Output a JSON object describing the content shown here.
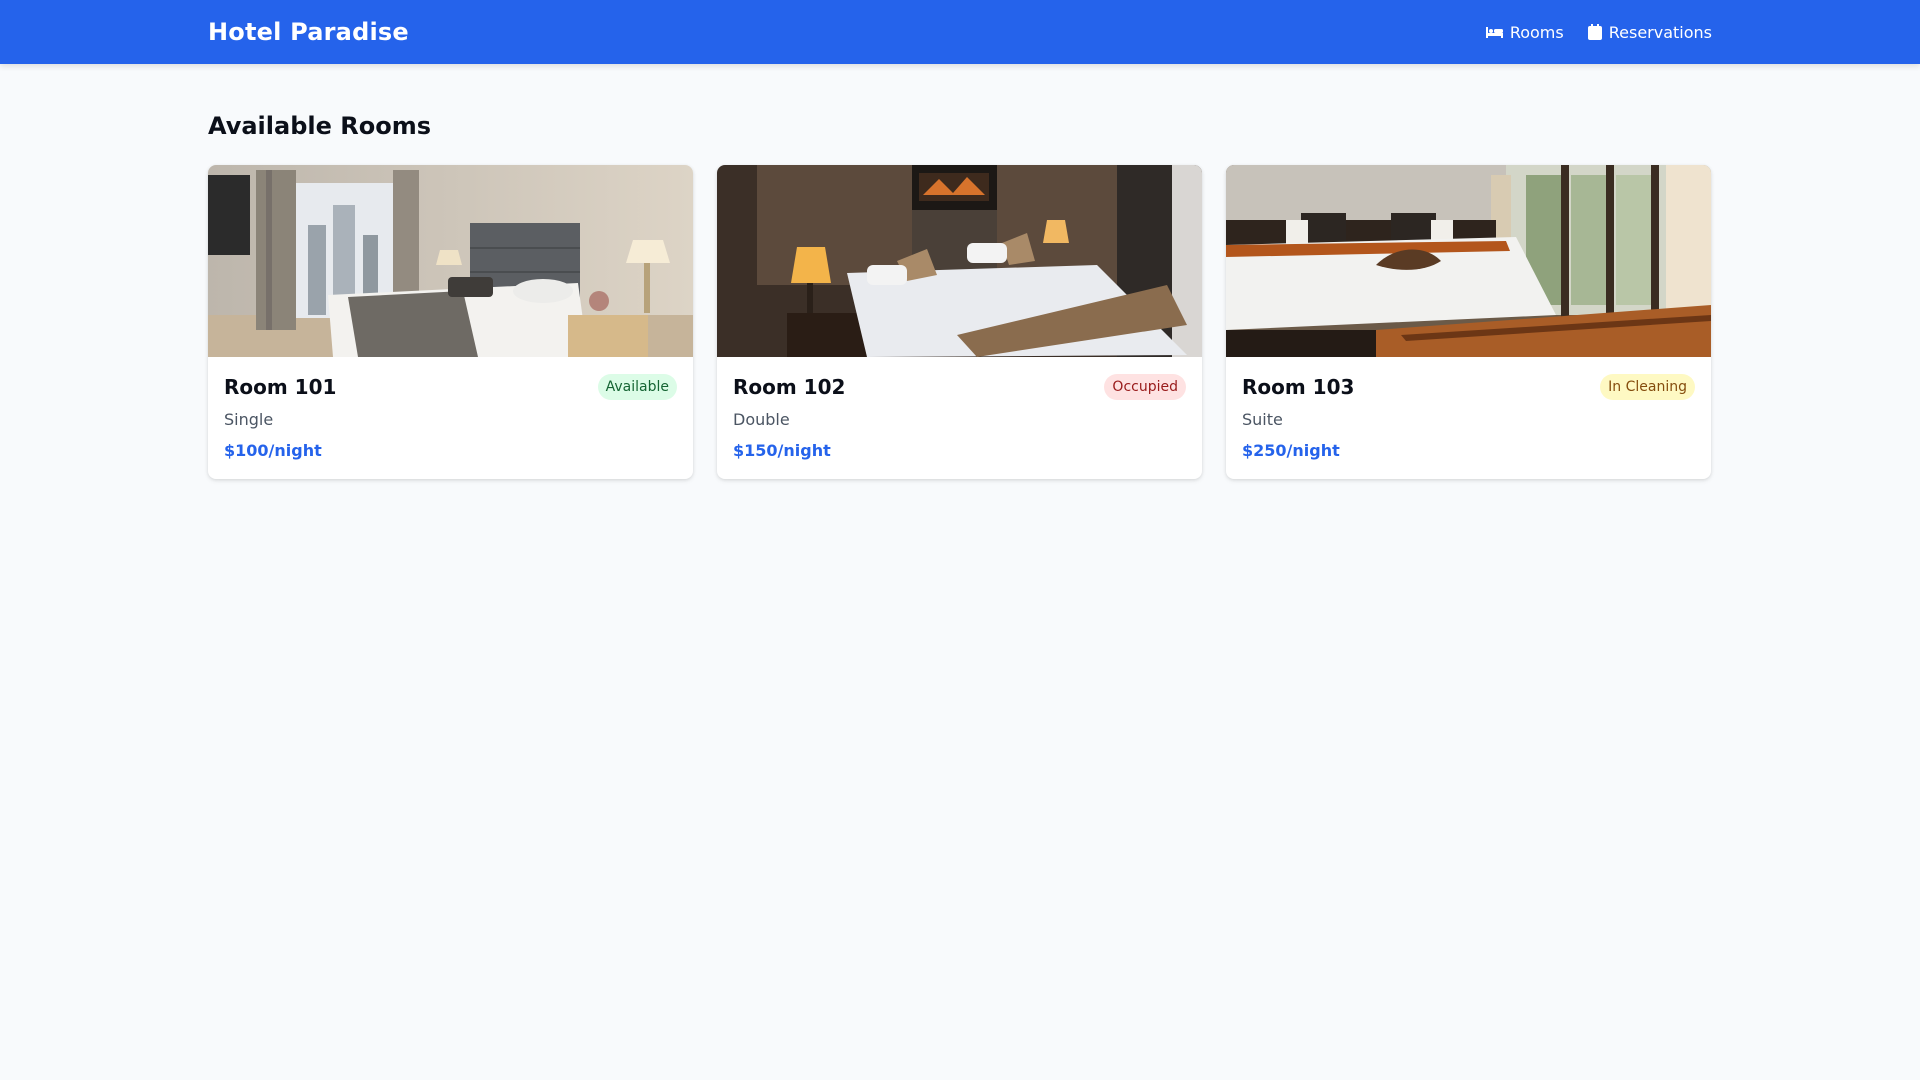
{
  "header": {
    "brand": "Hotel Paradise",
    "nav": [
      {
        "label": "Rooms",
        "icon": "bed-icon"
      },
      {
        "label": "Reservations",
        "icon": "calendar-icon"
      }
    ]
  },
  "main": {
    "title": "Available Rooms",
    "rooms": [
      {
        "name": "Room 101",
        "status": "Available",
        "type": "Single",
        "price": "$100/night"
      },
      {
        "name": "Room 102",
        "status": "Occupied",
        "type": "Double",
        "price": "$150/night"
      },
      {
        "name": "Room 103",
        "status": "In Cleaning",
        "type": "Suite",
        "price": "$250/night"
      }
    ]
  },
  "colors": {
    "brand_blue": "#2563eb",
    "page_bg": "#f8fafc",
    "status_available": "#dcfce7",
    "status_occupied": "#fee2e2",
    "status_cleaning": "#fef9c3"
  }
}
